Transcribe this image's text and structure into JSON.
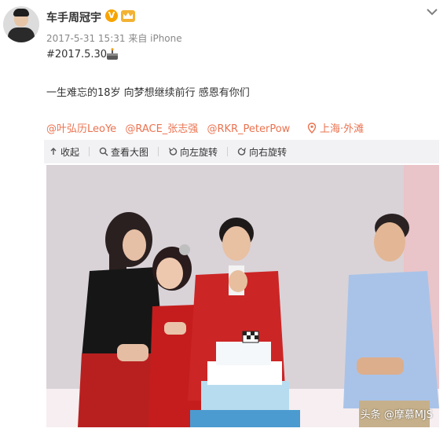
{
  "post": {
    "username": "车手周冠宇",
    "verified_badge": "V",
    "meta": "2017-5-31 15:31 来自 iPhone",
    "hashtag": "#2017.5.30",
    "body": "一生难忘的18岁 向梦想继续前行 感恩有你们",
    "mentions": [
      "@叶弘历LeoYe",
      "@RACE_张志强",
      "@RKR_PeterPow"
    ],
    "location": "上海·外滩"
  },
  "toolbar": {
    "items": [
      "收起",
      "查看大图",
      "向左旋转",
      "向右旋转"
    ]
  },
  "photo": {
    "watermark": "头条 @摩慕MJS"
  },
  "colors": {
    "accent": "#eb7350",
    "verified": "#f7a400",
    "toolbar_bg": "#f2f2f5"
  },
  "icons": [
    "avatar",
    "verified-icon",
    "crown-icon",
    "chevron-down-icon",
    "cake-emoji-icon",
    "location-pin-icon",
    "collapse-icon",
    "search-icon",
    "rotate-left-icon",
    "rotate-right-icon"
  ]
}
